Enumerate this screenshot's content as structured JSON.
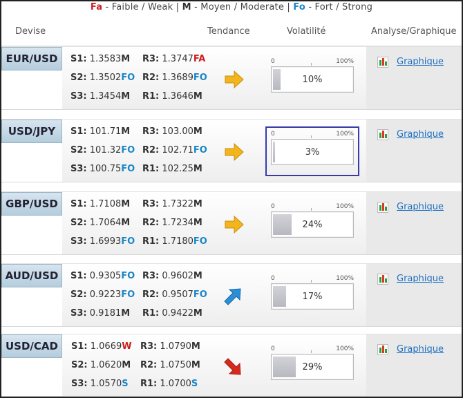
{
  "legend": {
    "fa_code": "Fa",
    "fa_text": " - Faible / Weak | ",
    "m_code": "M",
    "m_text": " - Moyen / Moderate | ",
    "fo_code": "Fo",
    "fo_text": " - Fort / Strong"
  },
  "headers": {
    "devise": "Devise",
    "tendance": "Tendance",
    "volatilite": "Volatilité",
    "analyse": "Analyse/Graphique"
  },
  "volatility_scale": {
    "min": "0",
    "max": "100%"
  },
  "colors": {
    "weak": "#cc1f1f",
    "moderate": "#333333",
    "strong": "#1a86c8",
    "trend_flat": "#f2b51c",
    "trend_up": "#2a8fd6",
    "trend_down": "#d72a1e"
  },
  "rows": [
    {
      "pair": "EUR/USD",
      "trend": "flat",
      "trend_icon": "arrow-right-icon",
      "volatility_pct": 10,
      "volatility_label": "10%",
      "link": "Graphique",
      "levels": {
        "s1": {
          "label": "S1:",
          "value": "1.3583",
          "tag": "M"
        },
        "s2": {
          "label": "S2:",
          "value": "1.3502",
          "tag": "FO"
        },
        "s3": {
          "label": "S3:",
          "value": "1.3454",
          "tag": "M"
        },
        "r3": {
          "label": "R3:",
          "value": "1.3747",
          "tag": "FA"
        },
        "r2": {
          "label": "R2:",
          "value": "1.3689",
          "tag": "FO"
        },
        "r1": {
          "label": "R1:",
          "value": "1.3646",
          "tag": "M"
        }
      }
    },
    {
      "pair": "USD/JPY",
      "trend": "flat",
      "trend_icon": "arrow-right-icon",
      "volatility_pct": 3,
      "volatility_label": "3%",
      "selected": true,
      "link": "Graphique",
      "levels": {
        "s1": {
          "label": "S1:",
          "value": "101.71",
          "tag": "M"
        },
        "s2": {
          "label": "S2:",
          "value": "101.32",
          "tag": "FO"
        },
        "s3": {
          "label": "S3:",
          "value": "100.75",
          "tag": "FO"
        },
        "r3": {
          "label": "R3:",
          "value": "103.00",
          "tag": "M"
        },
        "r2": {
          "label": "R2:",
          "value": "102.71",
          "tag": "FO"
        },
        "r1": {
          "label": "R1:",
          "value": "102.25",
          "tag": "M"
        }
      }
    },
    {
      "pair": "GBP/USD",
      "trend": "flat",
      "trend_icon": "arrow-right-icon",
      "volatility_pct": 24,
      "volatility_label": "24%",
      "link": "Graphique",
      "levels": {
        "s1": {
          "label": "S1:",
          "value": "1.7108",
          "tag": "M"
        },
        "s2": {
          "label": "S2:",
          "value": "1.7064",
          "tag": "M"
        },
        "s3": {
          "label": "S3:",
          "value": "1.6993",
          "tag": "FO"
        },
        "r3": {
          "label": "R3:",
          "value": "1.7322",
          "tag": "M"
        },
        "r2": {
          "label": "R2:",
          "value": "1.7234",
          "tag": "M"
        },
        "r1": {
          "label": "R1:",
          "value": "1.7180",
          "tag": "FO"
        }
      }
    },
    {
      "pair": "AUD/USD",
      "trend": "up",
      "trend_icon": "arrow-up-right-icon",
      "volatility_pct": 17,
      "volatility_label": "17%",
      "link": "Graphique",
      "levels": {
        "s1": {
          "label": "S1:",
          "value": "0.9305",
          "tag": "FO"
        },
        "s2": {
          "label": "S2:",
          "value": "0.9223",
          "tag": "FO"
        },
        "s3": {
          "label": "S3:",
          "value": "0.9181",
          "tag": "M"
        },
        "r3": {
          "label": "R3:",
          "value": "0.9602",
          "tag": "M"
        },
        "r2": {
          "label": "R2:",
          "value": "0.9507",
          "tag": "FO"
        },
        "r1": {
          "label": "R1:",
          "value": "0.9422",
          "tag": "M"
        }
      }
    },
    {
      "pair": "USD/CAD",
      "trend": "down",
      "trend_icon": "arrow-down-right-icon",
      "volatility_pct": 29,
      "volatility_label": "29%",
      "link": "Graphique",
      "levels": {
        "s1": {
          "label": "S1:",
          "value": "1.0669",
          "tag": "W"
        },
        "s2": {
          "label": "S2:",
          "value": "1.0620",
          "tag": "M"
        },
        "s3": {
          "label": "S3:",
          "value": "1.0570",
          "tag": "S"
        },
        "r3": {
          "label": "R3:",
          "value": "1.0790",
          "tag": "M"
        },
        "r2": {
          "label": "R2:",
          "value": "1.0750",
          "tag": "M"
        },
        "r1": {
          "label": "R1:",
          "value": "1.0700",
          "tag": "S"
        }
      }
    }
  ]
}
